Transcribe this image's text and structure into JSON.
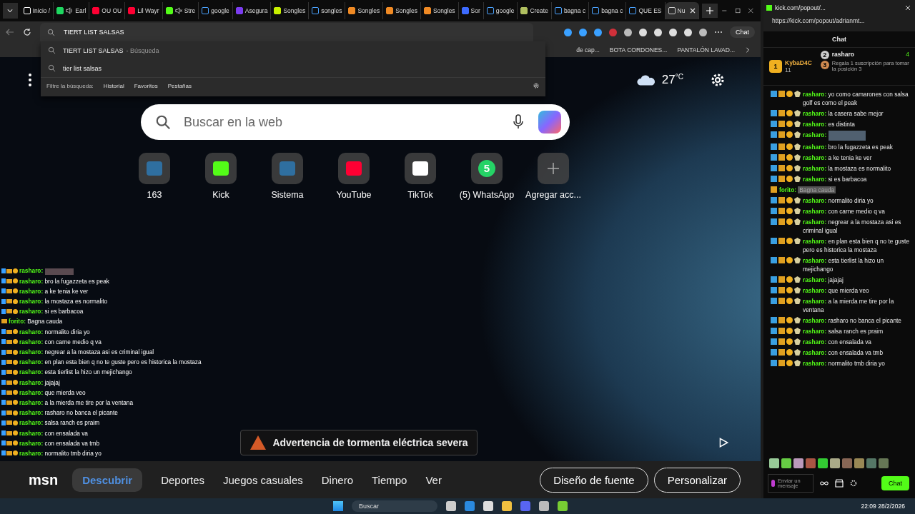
{
  "tabs": [
    {
      "label": "Inicio /",
      "kind": "x",
      "sound": false,
      "muted": false,
      "selected": false
    },
    {
      "label": "Earl",
      "kind": "spotify",
      "sound": true,
      "muted": false,
      "selected": false
    },
    {
      "label": "OU OU",
      "kind": "youtube",
      "sound": false,
      "muted": false,
      "selected": false
    },
    {
      "label": "Lil Wayr",
      "kind": "youtube",
      "sound": false,
      "muted": false,
      "selected": false
    },
    {
      "label": "Stre",
      "kind": "kick",
      "sound": false,
      "muted": true,
      "selected": false
    },
    {
      "label": "google",
      "kind": "search",
      "sound": false,
      "muted": false,
      "selected": false
    },
    {
      "label": "Asegura",
      "kind": "purple",
      "sound": false,
      "muted": false,
      "selected": false
    },
    {
      "label": "Songles",
      "kind": "arrow",
      "sound": false,
      "muted": false,
      "selected": false
    },
    {
      "label": "songles",
      "kind": "search",
      "sound": false,
      "muted": false,
      "selected": false
    },
    {
      "label": "Songles",
      "kind": "orange",
      "sound": false,
      "muted": false,
      "selected": false
    },
    {
      "label": "Songles",
      "kind": "orange",
      "sound": false,
      "muted": false,
      "selected": false
    },
    {
      "label": "Songles",
      "kind": "orange",
      "sound": false,
      "muted": false,
      "selected": false
    },
    {
      "label": "Sor",
      "kind": "circle",
      "sound": false,
      "muted": false,
      "selected": false
    },
    {
      "label": "google",
      "kind": "search",
      "sound": false,
      "muted": false,
      "selected": false
    },
    {
      "label": "Create",
      "kind": "create",
      "sound": false,
      "muted": false,
      "selected": false
    },
    {
      "label": "bagna c",
      "kind": "search",
      "sound": false,
      "muted": false,
      "selected": false
    },
    {
      "label": "bagna c",
      "kind": "search",
      "sound": false,
      "muted": false,
      "selected": false
    },
    {
      "label": "QUE ES",
      "kind": "search",
      "sound": false,
      "muted": false,
      "selected": false
    },
    {
      "label": "Nu",
      "kind": "page",
      "sound": false,
      "muted": false,
      "selected": true
    }
  ],
  "address": {
    "value": "TIERT LIST SALSAS"
  },
  "toolbar": {
    "chat_label": "Chat"
  },
  "bookmarks": [
    "de cap...",
    "BOTA CORDONES...",
    "PANTALÓN LAVAD..."
  ],
  "suggestions": [
    {
      "text": "TIERT LIST SALSAS",
      "hint": "- Búsqueda"
    },
    {
      "text": "tier list salsas"
    }
  ],
  "filter": {
    "label": "Filtre la búsqueda:",
    "items": [
      "Historial",
      "Favoritos",
      "Pestañas"
    ]
  },
  "weather": {
    "temp": "27",
    "unit": "°C"
  },
  "search": {
    "placeholder": "Buscar en la web"
  },
  "shortcuts": [
    {
      "label": "163",
      "kind": "ug"
    },
    {
      "label": "Kick",
      "kind": "kick"
    },
    {
      "label": "Sistema",
      "kind": "ug"
    },
    {
      "label": "YouTube",
      "kind": "youtube"
    },
    {
      "label": "TikTok",
      "kind": "tiktok"
    },
    {
      "label": "(5) WhatsApp",
      "kind": "badge",
      "badge": "5"
    },
    {
      "label": "Agregar acc...",
      "kind": "add"
    }
  ],
  "alert": "Advertencia de tormenta eléctrica severa",
  "nav": {
    "logo": "msn",
    "items": [
      {
        "label": "Descubrir",
        "selected": true
      },
      {
        "label": "Deportes",
        "selected": false
      },
      {
        "label": "Juegos casuales",
        "selected": false
      },
      {
        "label": "Dinero",
        "selected": false
      },
      {
        "label": "Tiempo",
        "selected": false
      },
      {
        "label": "Ver",
        "selected": false
      }
    ],
    "buttons": [
      "Diseño de fuente",
      "Personalizar"
    ]
  },
  "overlay_chat": [
    {
      "user": "rasharo:",
      "kind": "sub",
      "emote": true
    },
    {
      "user": "rasharo:",
      "text": "bro la fugazzeta es peak",
      "kind": "sub",
      "emote": false
    },
    {
      "user": "rasharo:",
      "text": "a ke tenia ke ver",
      "kind": "sub",
      "emote": false
    },
    {
      "user": "rasharo:",
      "text": "la mostaza es normalito",
      "kind": "sub",
      "emote": false
    },
    {
      "user": "rasharo:",
      "text": "si es barbacoa",
      "kind": "sub",
      "emote": false
    },
    {
      "user": "forito:",
      "text": "Bagna cauda",
      "kind": "plain",
      "emote": false
    },
    {
      "user": "rasharo:",
      "text": "normalito diria yo",
      "kind": "sub",
      "emote": false
    },
    {
      "user": "rasharo:",
      "text": "con carne medio q va",
      "kind": "sub",
      "emote": false
    },
    {
      "user": "rasharo:",
      "text": "negrear a la mostaza asi es criminal igual",
      "kind": "sub",
      "emote": false
    },
    {
      "user": "rasharo:",
      "text": "en plan esta bien q no te guste pero es historica la mostaza",
      "kind": "sub",
      "emote": false
    },
    {
      "user": "rasharo:",
      "text": "esta tierlist la hizo un mejichango",
      "kind": "sub",
      "emote": false
    },
    {
      "user": "rasharo:",
      "text": "jajajaj",
      "kind": "sub",
      "emote": false
    },
    {
      "user": "rasharo:",
      "text": "que mierda veo",
      "kind": "sub",
      "emote": false
    },
    {
      "user": "rasharo:",
      "text": "a la mierda me tire por la ventana",
      "kind": "sub",
      "emote": false
    },
    {
      "user": "rasharo:",
      "text": "rasharo no banca el picante",
      "kind": "sub",
      "emote": false
    },
    {
      "user": "rasharo:",
      "text": "salsa ranch es praim",
      "kind": "sub",
      "emote": false
    },
    {
      "user": "rasharo:",
      "text": "con ensalada va",
      "kind": "sub",
      "emote": false
    },
    {
      "user": "rasharo:",
      "text": "con ensalada va tmb",
      "kind": "sub",
      "emote": false
    },
    {
      "user": "rasharo:",
      "text": "normalito tmb diria yo",
      "kind": "sub",
      "emote": false
    }
  ],
  "taskbar": {
    "search": "Buscar",
    "time": "22:09",
    "date": "28/2/2026"
  },
  "chat_window": {
    "tab": "kick.com/popout/...",
    "url": "https://kick.com/popout/adrianmt...",
    "title": "Chat",
    "gifters": [
      {
        "rank": "1",
        "name": "KybaD4C",
        "count": "11"
      },
      {
        "rank": "2",
        "name": "rasharo",
        "count": "4"
      }
    ],
    "gift_note": {
      "rank": "3",
      "text": "Regala 1 suscripción para tomar la posición 3"
    },
    "messages": [
      {
        "user": "rasharo:",
        "text": "yo como camarones con salsa golf es como el peak",
        "kind": "sub",
        "emote": false,
        "spoiler": false
      },
      {
        "user": "rasharo:",
        "text": "la casera sabe mejor",
        "kind": "sub",
        "emote": false,
        "spoiler": false
      },
      {
        "user": "rasharo:",
        "text": "es distinta",
        "kind": "sub",
        "emote": false,
        "spoiler": false
      },
      {
        "user": "rasharo:",
        "kind": "sub",
        "emote": true,
        "spoiler": false
      },
      {
        "user": "rasharo:",
        "text": "bro la fugazzeta es peak",
        "kind": "sub",
        "emote": false,
        "spoiler": false
      },
      {
        "user": "rasharo:",
        "text": "a ke tenia ke ver",
        "kind": "sub",
        "emote": false,
        "spoiler": false
      },
      {
        "user": "rasharo:",
        "text": "la mostaza es normalito",
        "kind": "sub",
        "emote": false,
        "spoiler": false
      },
      {
        "user": "rasharo:",
        "text": "si es barbacoa",
        "kind": "sub",
        "emote": false,
        "spoiler": false
      },
      {
        "user": "forito:",
        "text": "Bagna cauda",
        "kind": "plain",
        "emote": false,
        "spoiler": true
      },
      {
        "user": "rasharo:",
        "text": "normalito diria yo",
        "kind": "sub",
        "emote": false,
        "spoiler": false
      },
      {
        "user": "rasharo:",
        "text": "con carne medio q va",
        "kind": "sub",
        "emote": false,
        "spoiler": false
      },
      {
        "user": "rasharo:",
        "text": "negrear a la mostaza asi es criminal igual",
        "kind": "sub",
        "emote": false,
        "spoiler": false
      },
      {
        "user": "rasharo:",
        "text": "en plan esta bien q no te guste pero es historica la mostaza",
        "kind": "sub",
        "emote": false,
        "spoiler": false
      },
      {
        "user": "rasharo:",
        "text": "esta tierlist la hizo un mejichango",
        "kind": "sub",
        "emote": false,
        "spoiler": false
      },
      {
        "user": "rasharo:",
        "text": "jajajaj",
        "kind": "sub",
        "emote": false,
        "spoiler": false
      },
      {
        "user": "rasharo:",
        "text": "que mierda veo",
        "kind": "sub",
        "emote": false,
        "spoiler": false
      },
      {
        "user": "rasharo:",
        "text": "a la mierda me tire por la ventana",
        "kind": "sub",
        "emote": false,
        "spoiler": false
      },
      {
        "user": "rasharo:",
        "text": "rasharo no banca el picante",
        "kind": "sub",
        "emote": false,
        "spoiler": false
      },
      {
        "user": "rasharo:",
        "text": "salsa ranch es praim",
        "kind": "sub",
        "emote": false,
        "spoiler": false
      },
      {
        "user": "rasharo:",
        "text": "con ensalada va",
        "kind": "sub",
        "emote": false,
        "spoiler": false
      },
      {
        "user": "rasharo:",
        "text": "con ensalada va tmb",
        "kind": "sub",
        "emote": false,
        "spoiler": false
      },
      {
        "user": "rasharo:",
        "text": "normalito tmb diria yo",
        "kind": "sub",
        "emote": false,
        "spoiler": false
      }
    ],
    "input_placeholder": "Enviar un mensaje",
    "send": "Chat"
  }
}
